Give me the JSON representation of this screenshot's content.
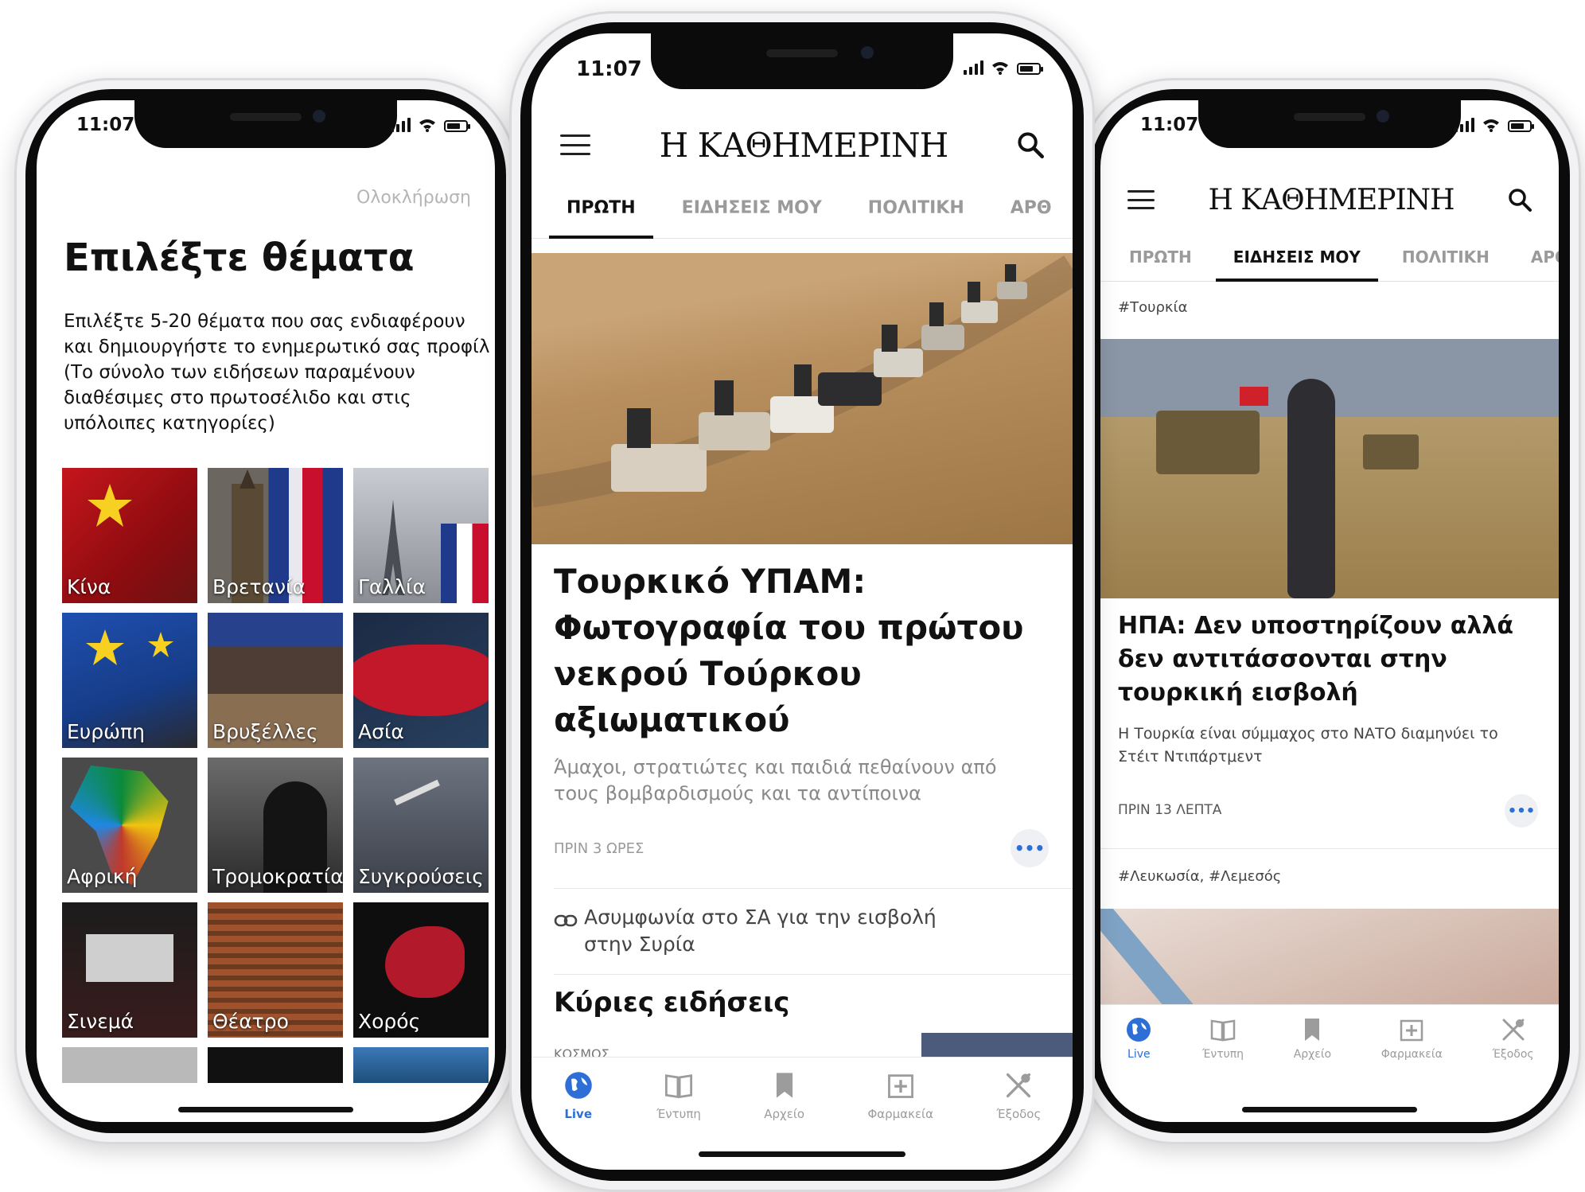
{
  "status": {
    "time": "11:07"
  },
  "topics_screen": {
    "done_label": "Ολοκλήρωση",
    "title": "Επιλέξτε θέματα",
    "description": "Επιλέξτε 5-20 θέματα που σας ενδιαφέρουν και δημιουργήστε το ενημερωτικό σας προφίλ (Το σύνολο των ειδήσεων παραμένουν διαθέσιμες στο πρωτοσέλιδο και στις υπόλοιπες κατηγορίες)",
    "topics": [
      {
        "label": "Κίνα"
      },
      {
        "label": "Βρετανία"
      },
      {
        "label": "Γαλλία"
      },
      {
        "label": "Ευρώπη"
      },
      {
        "label": "Βρυξέλλες"
      },
      {
        "label": "Ασία"
      },
      {
        "label": "Αφρική"
      },
      {
        "label": "Τρομοκρατία"
      },
      {
        "label": "Συγκρούσεις"
      },
      {
        "label": "Σινεμά"
      },
      {
        "label": "Θέατρο"
      },
      {
        "label": "Χορός"
      }
    ]
  },
  "app": {
    "logo": "Η ΚΑΘΗΜΕΡΙΝΗ",
    "tabs": [
      "ΠΡΩΤΗ",
      "ΕΙΔΗΣΕΙΣ ΜΟΥ",
      "ΠΟΛΙΤΙΚΗ",
      "ΑΡΘ"
    ],
    "nav": [
      "Live",
      "Έντυπη",
      "Αρχείο",
      "Φαρμακεία",
      "Έξοδος"
    ]
  },
  "front_page": {
    "active_tab": "ΠΡΩΤΗ",
    "headline": "Τουρκικό ΥΠΑΜ: Φωτογραφία του πρώτου νεκρού Τούρκου αξιωματικού",
    "subtitle": "Άμαχοι, στρατιώτες και παιδιά πεθαίνουν από τους βομβαρδισμούς και τα αντίποινα",
    "time": "ΠΡΙΝ 3 ΩΡΕΣ",
    "related_link": "Ασυμφωνία στο ΣΑ για την εισβολή στην Συρία",
    "section_title": "Κύριες ειδήσεις",
    "section_kicker": "ΚΟΣΜΟΣ"
  },
  "my_news": {
    "active_tab": "ΕΙΔΗΣΕΙΣ ΜΟΥ",
    "tag1": "#Τουρκία",
    "headline": "ΗΠΑ: Δεν υποστηρίζουν αλλά δεν αντιτάσσονται στην τουρκική εισβολή",
    "subtitle": "Η Τουρκία είναι σύμμαχος στο ΝΑΤΟ διαμηνύει το Στέιτ Ντιπάρτμεντ",
    "time": "ΠΡΙΝ 13 ΛΕΠΤΑ",
    "tag2": "#Λευκωσία, #Λεμεσός"
  },
  "colors": {
    "accent": "#2d6fd6",
    "text": "#111111",
    "muted": "#9a9a9a"
  }
}
